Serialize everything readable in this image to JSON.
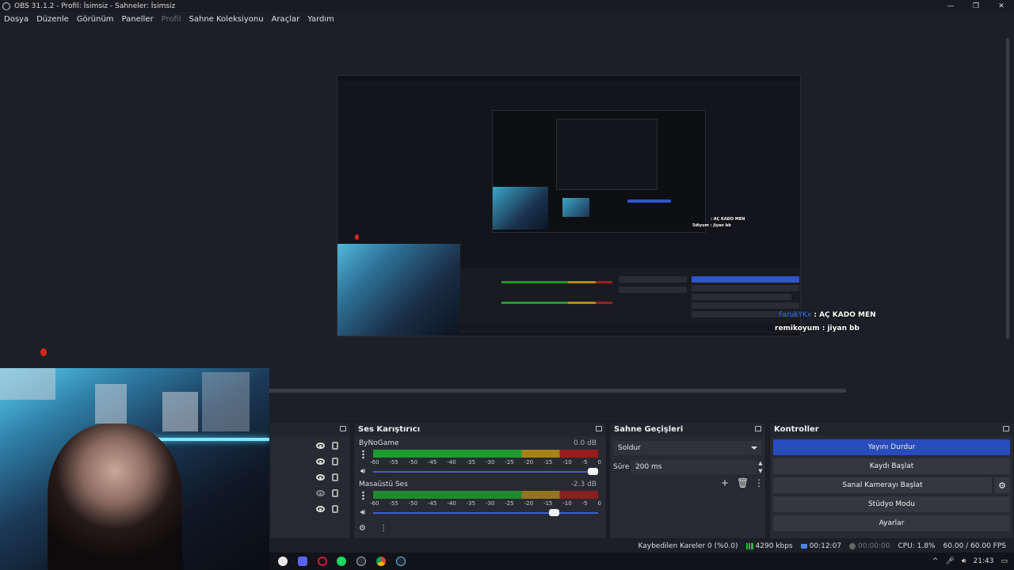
{
  "window": {
    "title": "OBS 31.1.2 - Profil: İsimsiz - Sahneler: İsimsiz",
    "controls": [
      "—",
      "❐",
      "✕"
    ]
  },
  "menu": [
    {
      "label": "Dosya",
      "enabled": true
    },
    {
      "label": "Düzenle",
      "enabled": true
    },
    {
      "label": "Görünüm",
      "enabled": true
    },
    {
      "label": "Paneller",
      "enabled": true
    },
    {
      "label": "Profil",
      "enabled": false
    },
    {
      "label": "Sahne Koleksiyonu",
      "enabled": true
    },
    {
      "label": "Araçlar",
      "enabled": true
    },
    {
      "label": "Yardım",
      "enabled": true
    }
  ],
  "chat": {
    "line1_user": "FarukYKx",
    "line1_msg": " : AÇ KADO MEN",
    "line2_user": "remikoyum",
    "line2_msg": " : jiyan bb",
    "inner_line1_msg": ": AÇ KADO MEN",
    "inner_line2": "5diyum : jiyan bb"
  },
  "mixer": {
    "title": "Ses Karıştırıcı",
    "channels": [
      {
        "name": "ByNoGame",
        "db": "0.0 dB",
        "volume": 1.0
      },
      {
        "name": "Masaüstü Ses",
        "db": "-2.3 dB",
        "volume": 0.82
      }
    ],
    "ticks": [
      "-60",
      "-55",
      "-50",
      "-45",
      "-40",
      "-35",
      "-30",
      "-25",
      "-20",
      "-15",
      "-10",
      "-5",
      "0"
    ]
  },
  "transitions": {
    "title": "Sahne Geçişleri",
    "selected": "Soldur",
    "duration_label": "Süre",
    "duration_value": "200 ms"
  },
  "controls": {
    "title": "Kontroller",
    "stop_stream": "Yayını Durdur",
    "start_record": "Kaydı Başlat",
    "start_virtualcam": "Sanal Kamerayı Başlat",
    "studio_mode": "Stüdyo Modu",
    "settings": "Ayarlar"
  },
  "status": {
    "dropped_frames": "Kaybedilen Kareler 0 (%0.0)",
    "bitrate": "4290 kbps",
    "stream_time": "00:12:07",
    "record_time": "00:00:00",
    "cpu": "CPU: 1.8%",
    "fps": "60.00 / 60.00 FPS"
  },
  "taskbar": {
    "clock": "21:43",
    "app_icons": [
      "unreal-icon",
      "discord-icon",
      "opera-icon",
      "spotify-icon",
      "obs-icon",
      "chrome-icon",
      "steam-icon"
    ]
  },
  "colors": {
    "accent": "#284cbc",
    "meter_green": "#1e9c2d",
    "meter_yellow": "#a68316",
    "meter_red": "#9b1c1c",
    "chat_user": "#3d7cff"
  }
}
